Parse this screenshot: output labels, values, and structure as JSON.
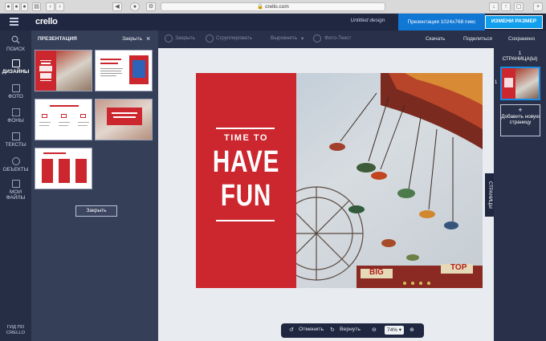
{
  "browser": {
    "url": "crello.com",
    "bar_color": "#d9d9d9"
  },
  "app": {
    "logo": "crello",
    "doc_title": "Untitled design",
    "size_label": "Презентация 1024x768 пикс",
    "resize_button": "ИЗМЕНИ РАЗМЕР",
    "accent_color": "#1177d4"
  },
  "sidebar": {
    "items": [
      {
        "label": "ПОИСК",
        "icon": "search-icon"
      },
      {
        "label": "ДИЗАЙНЫ",
        "icon": "designs-icon"
      },
      {
        "label": "ФОТО",
        "icon": "photo-icon"
      },
      {
        "label": "ФОНЫ",
        "icon": "backgrounds-icon"
      },
      {
        "label": "ТЕКСТЫ",
        "icon": "text-icon"
      },
      {
        "label": "ОБЪЕКТЫ",
        "icon": "objects-icon"
      },
      {
        "label": "МОИ ФАЙЛЫ",
        "icon": "files-icon"
      }
    ],
    "guide": "ГИД ПО CRELLO"
  },
  "panel": {
    "title": "ПРЕЗЕНТАЦИЯ",
    "close_label": "Закрыть",
    "close_button": "Закрыть",
    "thumbnails": [
      {
        "name": "have-fun-template"
      },
      {
        "name": "event-template"
      },
      {
        "name": "services-template"
      },
      {
        "name": "red-banner-template"
      },
      {
        "name": "pricing-template"
      }
    ]
  },
  "toolbar": {
    "close": "Закрыть",
    "group": "Сгруппировать",
    "align": "Выровнять",
    "photo_text": "Фото-Текст",
    "download": "Скачать",
    "share": "Поделиться",
    "saved": "Сохранено"
  },
  "design": {
    "line1": "TIME TO",
    "line2": "HAVE",
    "line3": "FUN",
    "red_color": "#cc262e",
    "sign_left": "BIG",
    "sign_right": "TOP"
  },
  "pages_tab": "СТРАНИЦЫ",
  "pages_panel": {
    "count_line1": "1",
    "count_line2": "СТРАНИЦА(Ы)",
    "page_number": "1",
    "add_label": "Добавить новую страницу"
  },
  "bottom": {
    "undo": "Отменить",
    "redo": "Вернуть",
    "zoom": "74%"
  }
}
